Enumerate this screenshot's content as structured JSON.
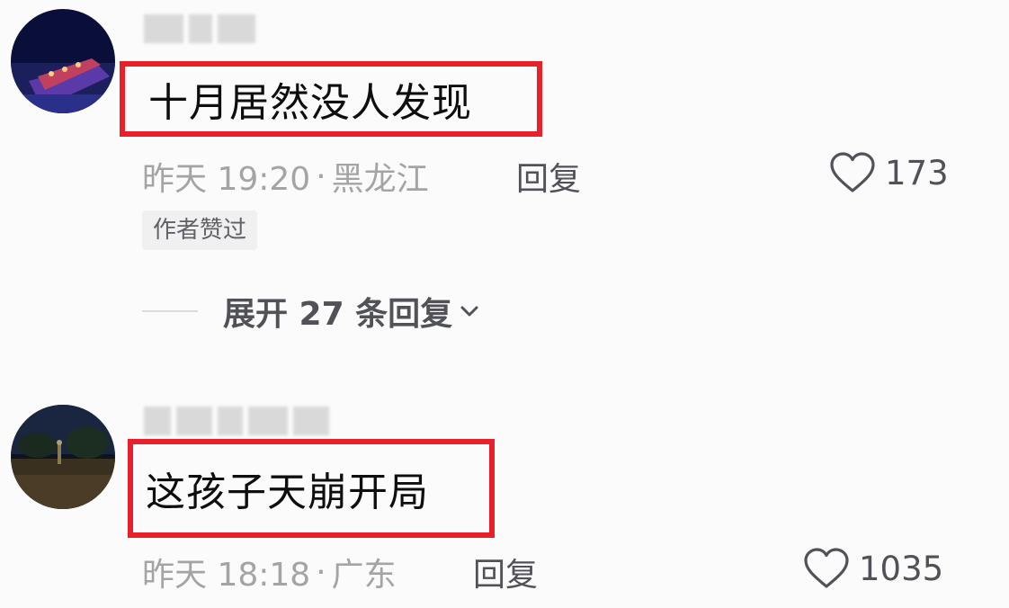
{
  "comments": [
    {
      "text": "十月居然没人发现",
      "time": "昨天 19:20",
      "separator": "·",
      "location": "黑龙江",
      "reply_label": "回复",
      "likes": "173",
      "badge": "作者赞过",
      "expand_label": "展开 27 条回复",
      "icons": {
        "like": "heart-outline-icon",
        "expand": "chevron-down-icon"
      }
    },
    {
      "text": "这孩子天崩开局",
      "time": "昨天 18:18",
      "separator": "·",
      "location": "广东",
      "reply_label": "回复",
      "likes": "1035",
      "icons": {
        "like": "heart-outline-icon"
      }
    }
  ],
  "colors": {
    "highlight_border": "#e8202a",
    "meta_text": "#a4a4a7",
    "action_text": "#505258",
    "background": "#fbfbfb"
  }
}
